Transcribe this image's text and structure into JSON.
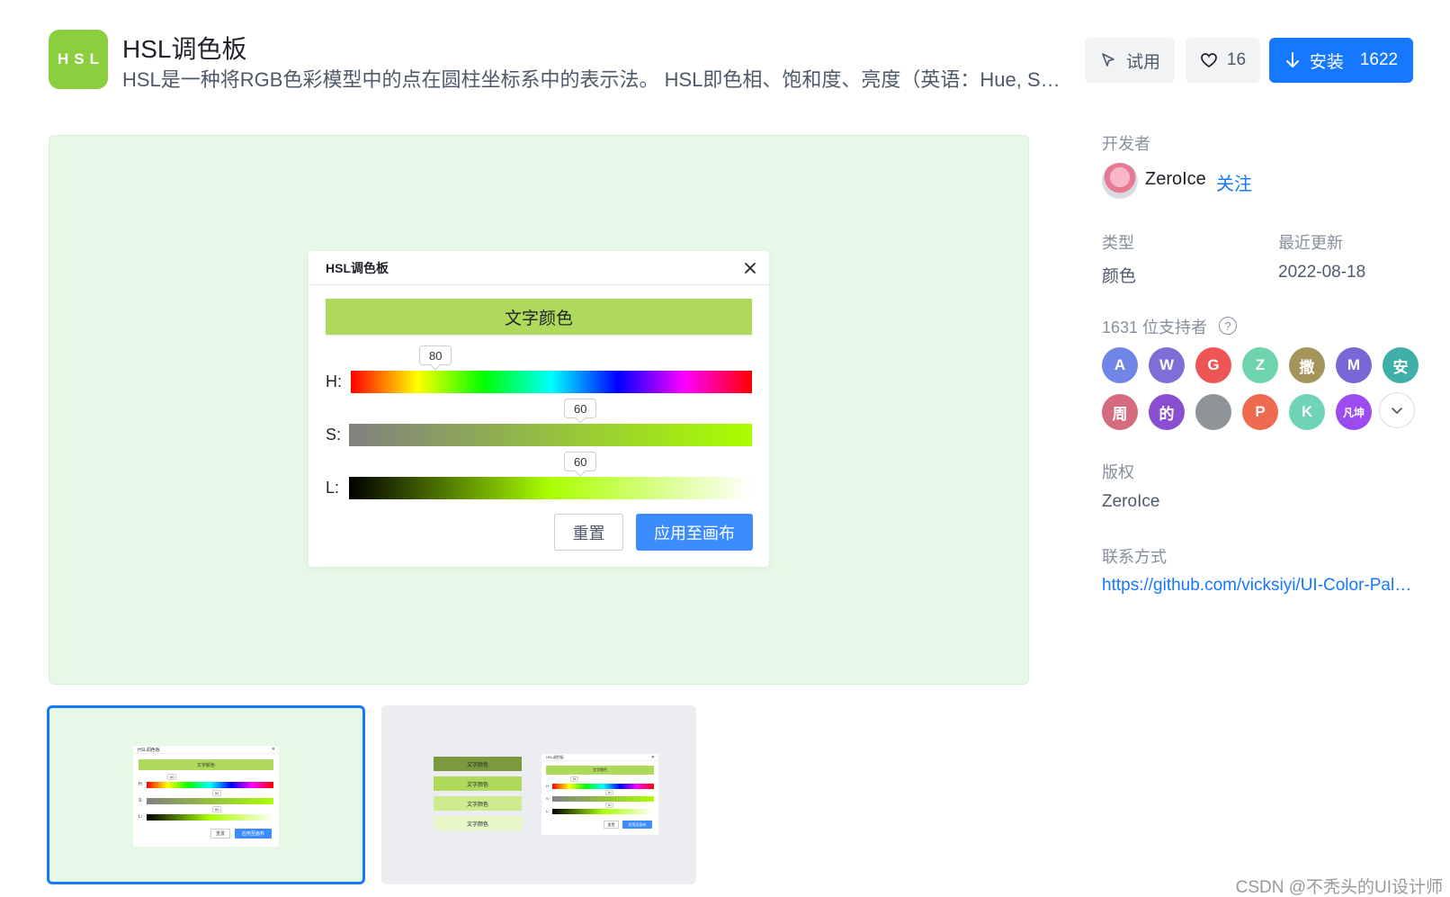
{
  "app": {
    "logo_text": "HSL",
    "title": "HSL调色板",
    "description": "HSL是一种将RGB色彩模型中的点在圆柱坐标系中的表示法。 HSL即色相、饱和度、亮度（英语：Hue, Saturation, Lightness）。"
  },
  "actions": {
    "try_label": "试用",
    "like_count": "16",
    "install_label": "安装",
    "install_count": "1622"
  },
  "preview": {
    "dialog_title": "HSL调色板",
    "chip_text": "文字颜色",
    "chip_color": "#afd95b",
    "sliders": [
      {
        "label": "H:",
        "value": "80"
      },
      {
        "label": "S:",
        "value": "60"
      },
      {
        "label": "L:",
        "value": "60"
      }
    ],
    "reset_label": "重置",
    "apply_label": "应用至画布"
  },
  "thumbnails": {
    "swatches": [
      {
        "text": "文字颜色",
        "color": "#7a9a3d"
      },
      {
        "text": "文字颜色",
        "color": "#afd95b"
      },
      {
        "text": "文字颜色",
        "color": "#cdeb8f"
      },
      {
        "text": "文字颜色",
        "color": "#e6f6c6"
      }
    ]
  },
  "sidebar": {
    "developer_label": "开发者",
    "developer_name": "ZeroIce",
    "follow_label": "关注",
    "type_label": "类型",
    "type_value": "颜色",
    "updated_label": "最近更新",
    "updated_value": "2022-08-18",
    "supporters_label": "1631 位支持者",
    "supporters": [
      {
        "text": "A",
        "color": "#6f86e6"
      },
      {
        "text": "W",
        "color": "#7f6ed8"
      },
      {
        "text": "G",
        "color": "#ee5555"
      },
      {
        "text": "Z",
        "color": "#6fd3ae"
      },
      {
        "text": "撒",
        "color": "#a4955a"
      },
      {
        "text": "M",
        "color": "#7b66d6"
      },
      {
        "text": "安",
        "color": "#3fb0a8"
      },
      {
        "text": "周",
        "color": "#d46b7e"
      },
      {
        "text": "的",
        "color": "#8a4fd0"
      },
      {
        "text": "",
        "color": "#8f9499"
      },
      {
        "text": "P",
        "color": "#ef6b4f"
      },
      {
        "text": "K",
        "color": "#6fd3b7"
      },
      {
        "text": "凡坤",
        "color": "#9b4bf0"
      }
    ],
    "copyright_label": "版权",
    "copyright_value": "ZeroIce",
    "contact_label": "联系方式",
    "contact_value": "https://github.com/vicksiyi/UI-Color-Palette"
  },
  "watermark": "CSDN @不秃头的UI设计师"
}
